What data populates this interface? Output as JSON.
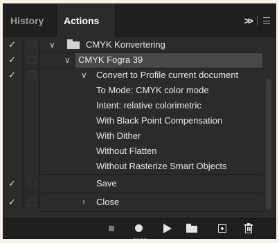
{
  "tabs": {
    "history": "History",
    "actions": "Actions"
  },
  "tab_controls": {
    "collapse": ">>"
  },
  "rows": [
    {
      "type": "set",
      "label": "CMYK Konvertering",
      "checked": true,
      "expanded": true
    },
    {
      "type": "action",
      "label": "CMYK Fogra 39",
      "checked": true,
      "expanded": true,
      "selected": true
    },
    {
      "type": "command",
      "label": "Convert to Profile current document",
      "checked": true,
      "expanded": true
    },
    {
      "type": "detail",
      "label": "To Mode: CMYK color mode"
    },
    {
      "type": "detail",
      "label": "Intent: relative colorimetric"
    },
    {
      "type": "detail",
      "label": "With Black Point Compensation"
    },
    {
      "type": "detail",
      "label": "With Dither"
    },
    {
      "type": "detail",
      "label": "Without Flatten"
    },
    {
      "type": "detail",
      "label": "Without Rasterize Smart Objects"
    },
    {
      "type": "command",
      "label": "Save",
      "checked": true,
      "expanded": false
    },
    {
      "type": "command",
      "label": "Close",
      "checked": true,
      "expanded": false,
      "collapsed": true
    }
  ],
  "icons": {
    "check": "checkmark-icon",
    "chevron_down": "chevron-down-icon",
    "chevron_right": "chevron-right-icon",
    "folder": "folder-icon"
  },
  "footer": [
    "stop-icon",
    "record-icon",
    "play-icon",
    "new-set-icon",
    "new-action-icon",
    "delete-icon"
  ],
  "colors": {
    "panel": "#2b2b2b",
    "tabbar": "#1f1f1f",
    "selected_row": "#494949",
    "text": "#e8e8e8"
  }
}
